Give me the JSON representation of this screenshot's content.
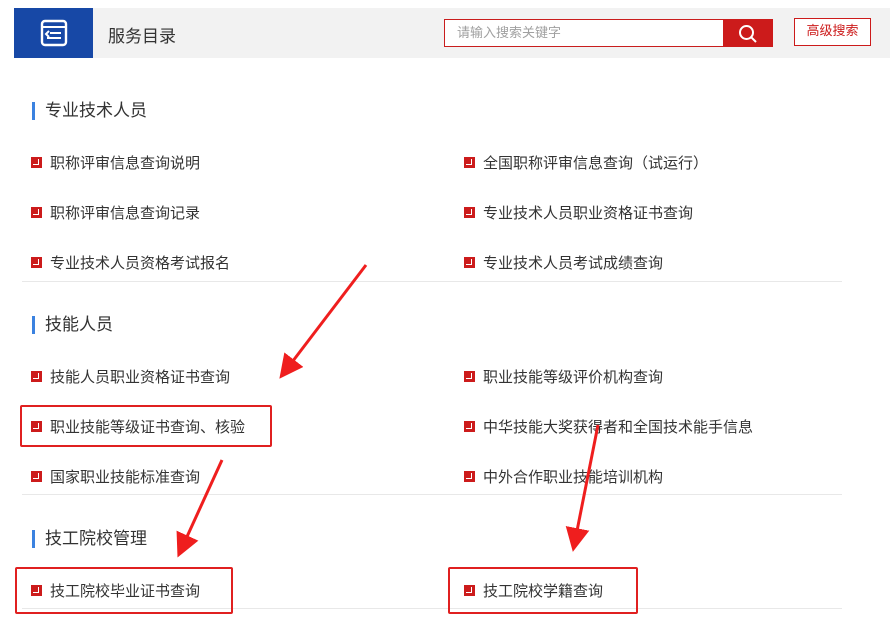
{
  "header": {
    "title": "服务目录",
    "logo_icon": "catalog-icon",
    "search_placeholder": "请输入搜索关键字",
    "search_icon": "search-icon",
    "advanced_search_label": "高级搜索",
    "accent_color": "#cc1b1b",
    "brand_color": "#1748a6"
  },
  "sections": [
    {
      "title": "专业技术人员",
      "items": [
        "职称评审信息查询说明",
        "全国职称评审信息查询（试运行）",
        "职称评审信息查询记录",
        "专业技术人员职业资格证书查询",
        "专业技术人员资格考试报名",
        "专业技术人员考试成绩查询"
      ]
    },
    {
      "title": "技能人员",
      "items": [
        "技能人员职业资格证书查询",
        "职业技能等级评价机构查询",
        "职业技能等级证书查询、核验",
        "中华技能大奖获得者和全国技术能手信息",
        "国家职业技能标准查询",
        "中外合作职业技能培训机构"
      ]
    },
    {
      "title": "技工院校管理",
      "items": [
        "技工院校毕业证书查询",
        "技工院校学籍查询"
      ]
    }
  ]
}
